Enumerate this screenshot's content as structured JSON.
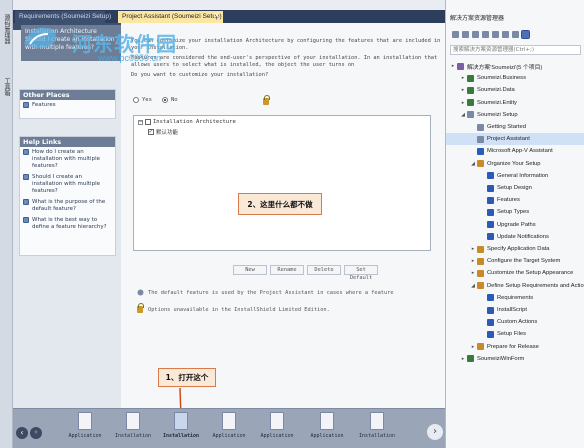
{
  "left_strip": {
    "labels": [
      "源码管理器",
      "工具箱"
    ]
  },
  "tabs": [
    {
      "label": "Requirements (Soumeizi Setup)",
      "active": false
    },
    {
      "label": "Project Assistant (Soumeizi Setup)",
      "active": true
    }
  ],
  "watermark": {
    "title": "河东软件园",
    "url": "www.pc0359.cn"
  },
  "left_pane": {
    "header": [
      "Installation Architecture",
      "Should I create an installation",
      "with multiple features?"
    ],
    "other_places": {
      "title": "Other Places",
      "items": [
        "Features"
      ]
    },
    "help_links": {
      "title": "Help Links",
      "items": [
        "How do I create an installation with multiple features?",
        "Should I create an installation with multiple features?",
        "What is the purpose of the default feature?",
        "What is the best way to define a feature hierarchy?"
      ]
    }
  },
  "content": {
    "intro1": "You can customize your installation Architecture by configuring the features that are included in your installation.",
    "intro2": "Features are considered the end-user's perspective of your installation. In an installation that allows users to select what is installed, the object the user turns on",
    "question": "Do you want to customize your installation?",
    "radio_yes": "Yes",
    "radio_no": "No",
    "tree_root": "Installation Architecture",
    "tree_child": "默认功能",
    "buttons": [
      "New",
      "Rename",
      "Delete",
      "Set Default"
    ],
    "note1": "The default feature is used by the Project Assistant in cases where a feature",
    "note2": "Options unavailable in the InstallShield Limited Edition."
  },
  "callouts": {
    "c1": "1、打开这个",
    "c2": "2、这里什么都不做"
  },
  "bottom_nav": {
    "items": [
      {
        "label": "Application"
      },
      {
        "label": "Installation"
      },
      {
        "label": "Installation",
        "active": true
      },
      {
        "label": "Application"
      },
      {
        "label": "Application"
      },
      {
        "label": "Application"
      },
      {
        "label": "Installation"
      }
    ]
  },
  "solution_explorer": {
    "title": "解决方案资源管理器",
    "search_placeholder": "搜索解决方案资源管理器(Ctrl+;)",
    "items": [
      {
        "label": "解决方案'Soumeizi'(5 个项目)",
        "color": "#7b5ea7"
      },
      {
        "label": "Soumeizi.Business",
        "color": "#3a7a3a"
      },
      {
        "label": "Soumeizi.Data",
        "color": "#3a7a3a"
      },
      {
        "label": "Soumeizi.Entity",
        "color": "#3a7a3a"
      },
      {
        "label": "Soumeizi Setup",
        "color": "#7a8aa5"
      },
      {
        "label": "Getting Started",
        "color": "#7a8aa5"
      },
      {
        "label": "Project Assistant",
        "color": "#7a8aa5",
        "selected": true
      },
      {
        "label": "Microsoft App-V Assistant",
        "color": "#2b5bb8"
      },
      {
        "label": "Organize Your Setup",
        "color": "#c98a2a"
      },
      {
        "label": "General Information",
        "color": "#2b5bb8"
      },
      {
        "label": "Setup Design",
        "color": "#2b5bb8"
      },
      {
        "label": "Features",
        "color": "#2b5bb8"
      },
      {
        "label": "Setup Types",
        "color": "#2b5bb8"
      },
      {
        "label": "Upgrade Paths",
        "color": "#2b5bb8"
      },
      {
        "label": "Update Notifications",
        "color": "#2b5bb8"
      },
      {
        "label": "Specify Application Data",
        "color": "#c98a2a"
      },
      {
        "label": "Configure the Target System",
        "color": "#c98a2a"
      },
      {
        "label": "Customize the Setup Appearance",
        "color": "#c98a2a"
      },
      {
        "label": "Define Setup Requirements and Actions",
        "color": "#c98a2a"
      },
      {
        "label": "Requirements",
        "color": "#2b5bb8"
      },
      {
        "label": "InstallScript",
        "color": "#2b5bb8"
      },
      {
        "label": "Custom Actions",
        "color": "#2b5bb8"
      },
      {
        "label": "Setup Files",
        "color": "#2b5bb8"
      },
      {
        "label": "Prepare for Release",
        "color": "#c98a2a"
      },
      {
        "label": "SoumeiziWinForm",
        "color": "#3a7a3a"
      }
    ]
  }
}
